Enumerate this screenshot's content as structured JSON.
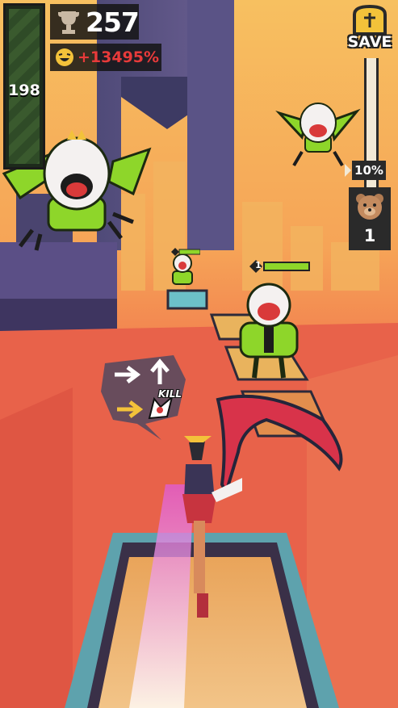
{
  "hud": {
    "health_value": "198",
    "score": "257",
    "multiplier": "+13495%",
    "save_label": "SAVE",
    "save_progress_label": "10%",
    "save_progress": 0.1,
    "bear_count": "1"
  },
  "prompt": {
    "kill_label": "KILL",
    "arrows": [
      "right",
      "up",
      "right"
    ]
  },
  "enemies": [
    {
      "id": "clown-drone-left-large"
    },
    {
      "id": "clown-drone-right"
    },
    {
      "id": "clown-drone-far"
    },
    {
      "id": "clown-robot-center",
      "level": "1"
    }
  ],
  "colors": {
    "sky": "#f4a65a",
    "ground": "#e8664a",
    "enemy_green": "#8ed62a",
    "clown_red": "#d93a3a",
    "pink_trail": "#e05bd6",
    "hud_dark": "#1f1f1f"
  }
}
